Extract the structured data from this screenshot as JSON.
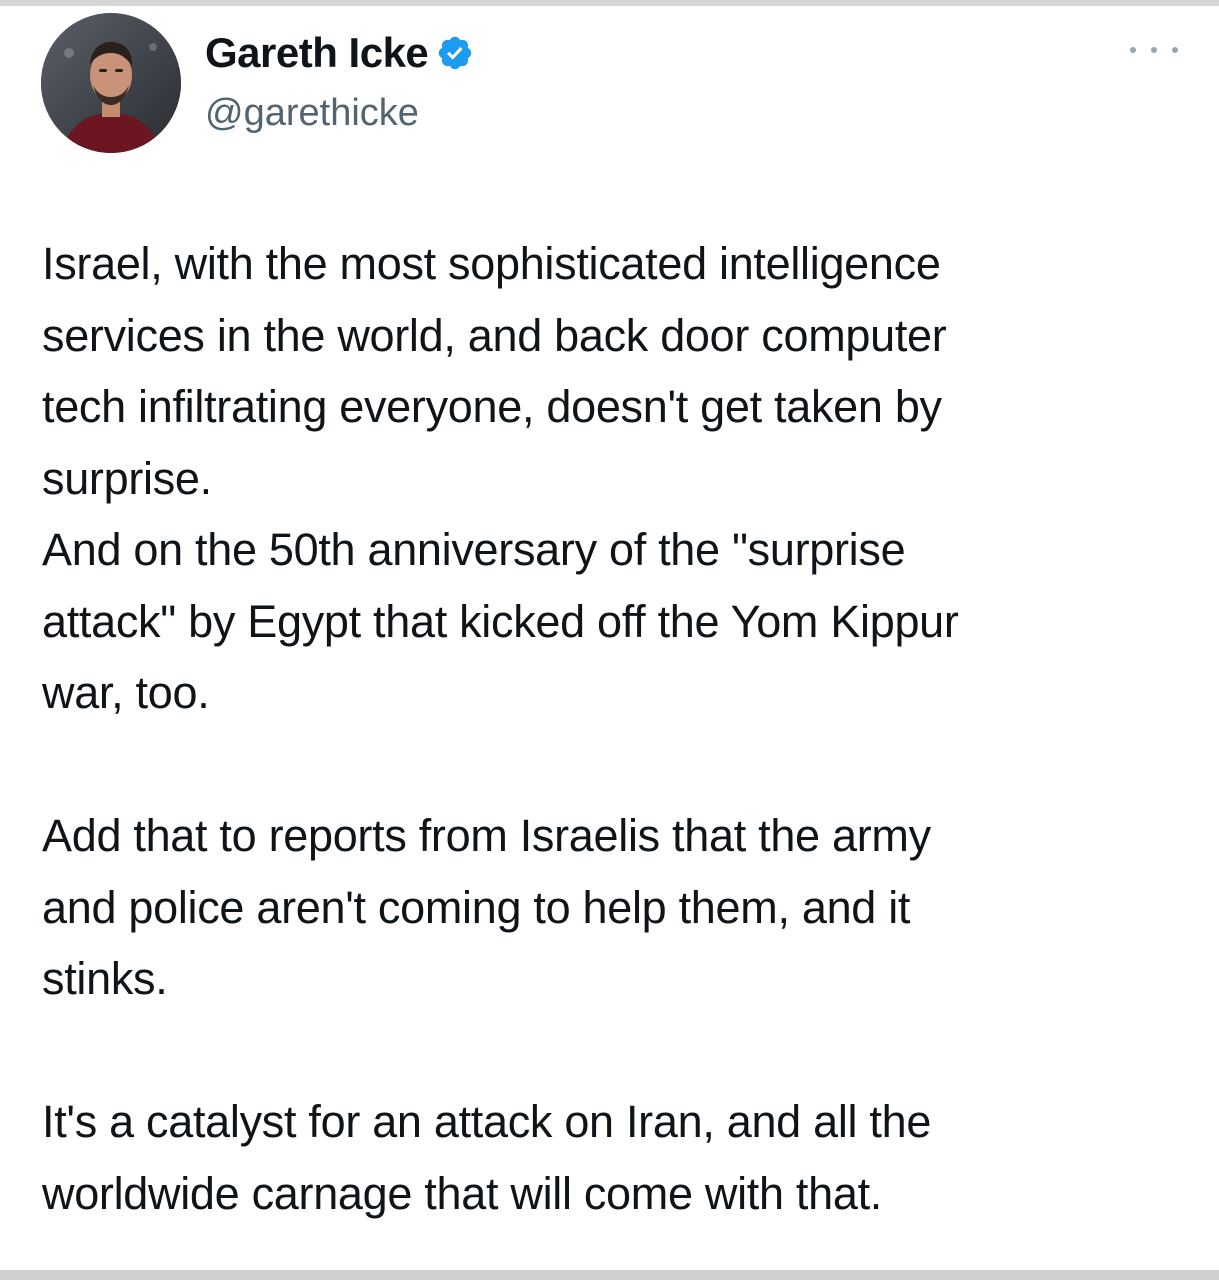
{
  "author": {
    "display_name": "Gareth Icke",
    "handle": "@garethicke",
    "verified": true,
    "avatar_icon": "profile-photo"
  },
  "menu": {
    "icon": "more-options-icon"
  },
  "tweet": {
    "paragraphs": [
      {
        "lines": [
          "Israel, with the most sophisticated intelligence",
          "services in the world, and back door computer",
          "tech infiltrating everyone, doesn't get taken by",
          "surprise.",
          "And on the 50th anniversary of the \"surprise",
          "attack\" by Egypt that kicked off the Yom Kippur",
          "war, too."
        ]
      },
      {
        "lines": [
          "Add that to reports from Israelis that the army",
          "and police aren't coming to help them, and it",
          "stinks."
        ]
      },
      {
        "lines": [
          "It's a catalyst for an attack on Iran, and all the",
          "worldwide carnage that will come with that."
        ]
      }
    ]
  },
  "colors": {
    "text": "#0f1419",
    "secondary_text": "#536471",
    "verified_blue": "#1d9bf0"
  }
}
